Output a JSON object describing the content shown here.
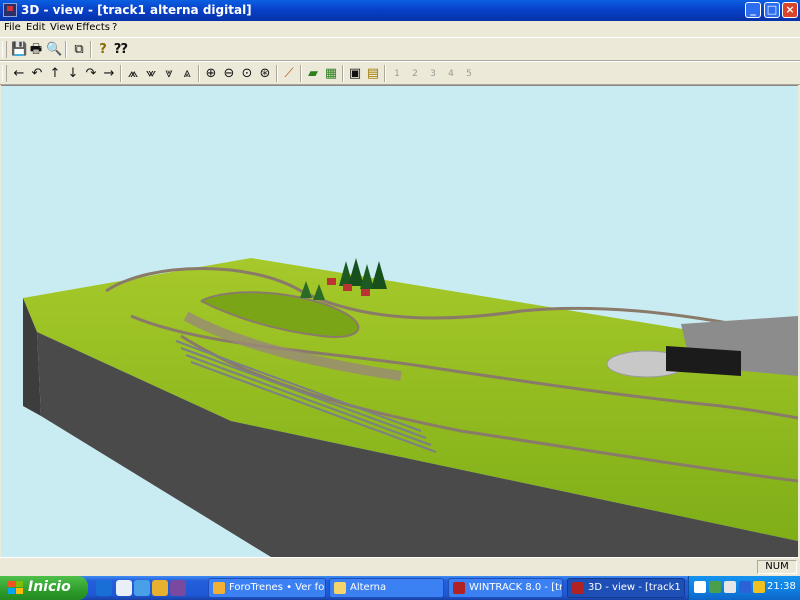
{
  "window": {
    "title": "3D - view - [track1 alterna digital]"
  },
  "menu": [
    "File",
    "Edit",
    "View",
    "Effects",
    "?"
  ],
  "toolbar1": [
    {
      "name": "save-icon",
      "glyph": "💾"
    },
    {
      "name": "print-icon",
      "glyph": "🖶"
    },
    {
      "name": "print-preview-icon",
      "glyph": "🔍"
    },
    {
      "name": "copy-icon",
      "glyph": "⧉"
    },
    {
      "name": "help-icon",
      "glyph": "?"
    },
    {
      "name": "context-help-icon",
      "glyph": "⁇"
    }
  ],
  "toolbar2": [
    {
      "name": "move-left-icon",
      "glyph": "←",
      "enabled": true
    },
    {
      "name": "turn-left-icon",
      "glyph": "↶",
      "enabled": true
    },
    {
      "name": "move-up-icon",
      "glyph": "↑",
      "enabled": true
    },
    {
      "name": "move-down-icon",
      "glyph": "↓",
      "enabled": true
    },
    {
      "name": "turn-right-icon",
      "glyph": "↷",
      "enabled": true
    },
    {
      "name": "move-right-icon",
      "glyph": "→",
      "enabled": true
    },
    {
      "name": "camera-tilt-up-icon",
      "glyph": "⩕",
      "enabled": true
    },
    {
      "name": "camera-tilt-down-icon",
      "glyph": "⩖",
      "enabled": true
    },
    {
      "name": "camera-walk-icon",
      "glyph": "⩔",
      "enabled": true
    },
    {
      "name": "camera-fly-icon",
      "glyph": "⩓",
      "enabled": true
    },
    {
      "name": "zoom-in-icon",
      "glyph": "⊕",
      "enabled": true
    },
    {
      "name": "zoom-out-icon",
      "glyph": "⊖",
      "enabled": true
    },
    {
      "name": "zoom-icon",
      "glyph": "⊙",
      "enabled": true
    },
    {
      "name": "zoom-all-icon",
      "glyph": "⊛",
      "enabled": true
    },
    {
      "name": "track-tool-icon",
      "glyph": "⟋",
      "enabled": true
    },
    {
      "name": "terrain-icon",
      "glyph": "▰",
      "enabled": true
    },
    {
      "name": "grid-icon",
      "glyph": "▦",
      "enabled": true
    },
    {
      "name": "fit-view-icon",
      "glyph": "▣",
      "enabled": true
    },
    {
      "name": "screenshot-icon",
      "glyph": "▤",
      "enabled": true
    },
    {
      "name": "camera-1-icon",
      "glyph": "1",
      "enabled": false
    },
    {
      "name": "camera-2-icon",
      "glyph": "2",
      "enabled": false
    },
    {
      "name": "camera-3-icon",
      "glyph": "3",
      "enabled": false
    },
    {
      "name": "camera-4-icon",
      "glyph": "4",
      "enabled": false
    },
    {
      "name": "camera-5-icon",
      "glyph": "5",
      "enabled": false
    }
  ],
  "status": {
    "num": "NUM"
  },
  "taskbar": {
    "start_label": "Inicio",
    "tasks": [
      {
        "label": "ForoTrenes • Ver fo...",
        "color": "#f2b134",
        "active": false
      },
      {
        "label": "Alterna",
        "color": "#f4d46b",
        "active": false
      },
      {
        "label": "WINTRACK 8.0 - [tr...",
        "color": "#b22222",
        "active": false
      },
      {
        "label": "3D - view - [track1 a...",
        "color": "#b22222",
        "active": true
      }
    ],
    "clock": "21:38"
  },
  "colors": {
    "sky": "#c9ecf2",
    "grass": "#8fbf1f",
    "grass_dark": "#6f9a14",
    "base_side": "#4a4a4a",
    "track": "#8a7a6a"
  }
}
